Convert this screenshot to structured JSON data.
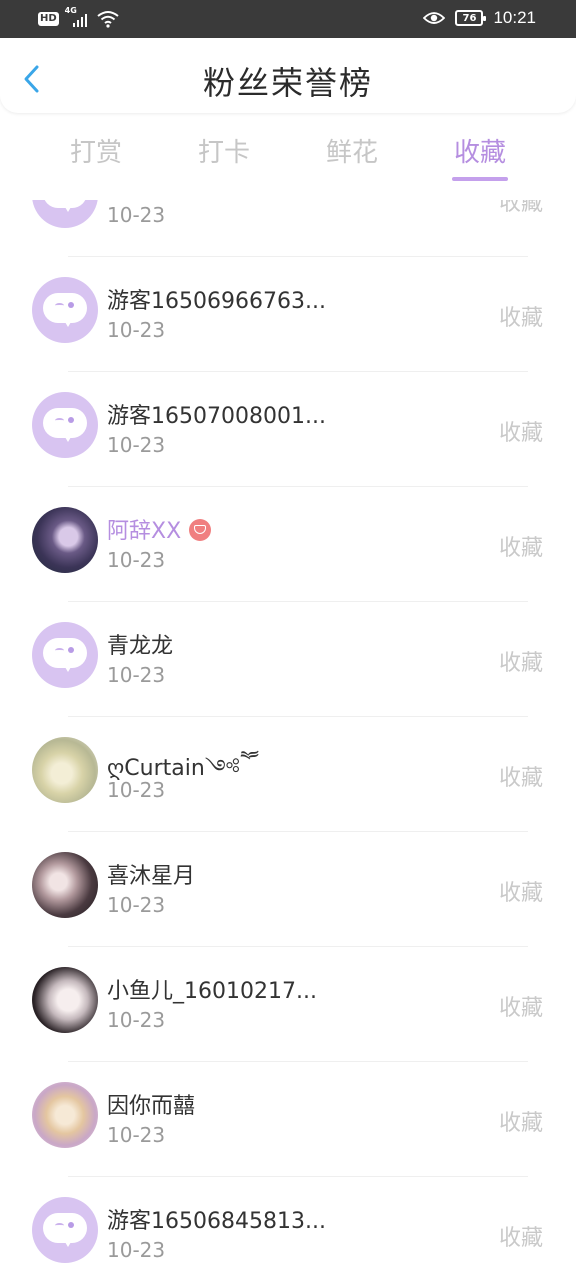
{
  "status_bar": {
    "hd": "HD",
    "network": "4G",
    "battery": "76",
    "time": "10:21"
  },
  "header": {
    "title": "粉丝荣誉榜",
    "back_icon": "chevron-left-icon"
  },
  "tabs": [
    {
      "label": "打赏",
      "active": false
    },
    {
      "label": "打卡",
      "active": false
    },
    {
      "label": "鲜花",
      "active": false
    },
    {
      "label": "收藏",
      "active": true
    }
  ],
  "list": {
    "partial_top": {
      "date": "10-23",
      "action": "收藏"
    },
    "items": [
      {
        "name": "游客16506966763...",
        "date": "10-23",
        "action": "收藏",
        "avatar": "default"
      },
      {
        "name": "游客16507008001...",
        "date": "10-23",
        "action": "收藏",
        "avatar": "default"
      },
      {
        "name": "阿辞XX",
        "date": "10-23",
        "action": "收藏",
        "avatar": "photo",
        "vip": true
      },
      {
        "name": "青龙龙",
        "date": "10-23",
        "action": "收藏",
        "avatar": "default"
      },
      {
        "name": "ღCurtain༺ཽ",
        "date": "10-23",
        "action": "收藏",
        "avatar": "photo"
      },
      {
        "name": "喜沐星月",
        "date": "10-23",
        "action": "收藏",
        "avatar": "photo"
      },
      {
        "name": "小鱼儿_16010217...",
        "date": "10-23",
        "action": "收藏",
        "avatar": "photo"
      },
      {
        "name": "因你而囍",
        "date": "10-23",
        "action": "收藏",
        "avatar": "photo"
      },
      {
        "name": "游客16506845813...",
        "date": "10-23",
        "action": "收藏",
        "avatar": "default"
      }
    ]
  },
  "colors": {
    "accent": "#b58ee0",
    "tab_inactive": "#c6c6c6",
    "default_avatar": "#d8c4f1",
    "vip_badge": "#f07f80",
    "back_arrow": "#3aa6e8"
  }
}
